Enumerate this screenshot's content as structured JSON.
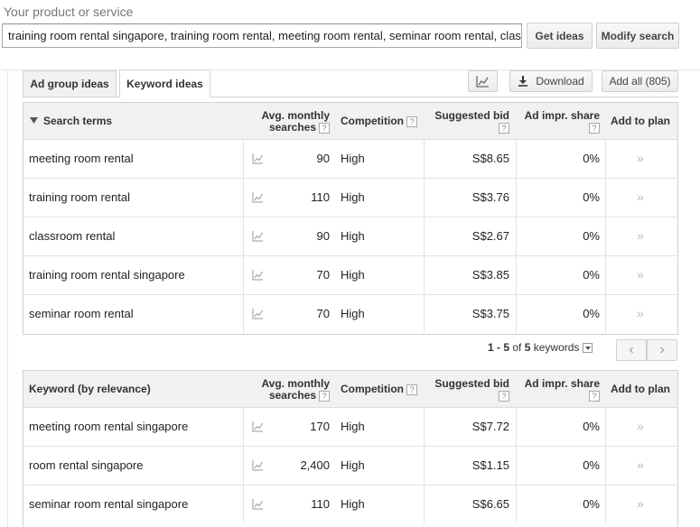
{
  "header": {
    "product_label": "Your product or service",
    "search_value": "training room rental singapore, training room rental, meeting room rental, seminar room rental, classroom rental",
    "get_ideas": "Get ideas",
    "modify_search": "Modify search"
  },
  "tabs": [
    {
      "label": "Ad group ideas"
    },
    {
      "label": "Keyword ideas"
    }
  ],
  "toolbar": {
    "download": "Download",
    "add_all": "Add all (805)"
  },
  "search_terms_table": {
    "headers": {
      "term": "Search terms",
      "avg_line1": "Avg. monthly",
      "avg_line2": "searches",
      "competition": "Competition",
      "bid": "Suggested bid",
      "impr": "Ad impr. share",
      "add": "Add to plan"
    },
    "rows": [
      {
        "term": "meeting room rental",
        "searches": "90",
        "competition": "High",
        "bid": "S$8.65",
        "impr": "0%"
      },
      {
        "term": "training room rental",
        "searches": "110",
        "competition": "High",
        "bid": "S$3.76",
        "impr": "0%"
      },
      {
        "term": "classroom rental",
        "searches": "90",
        "competition": "High",
        "bid": "S$2.67",
        "impr": "0%"
      },
      {
        "term": "training room rental singapore",
        "searches": "70",
        "competition": "High",
        "bid": "S$3.85",
        "impr": "0%"
      },
      {
        "term": "seminar room rental",
        "searches": "70",
        "competition": "High",
        "bid": "S$3.75",
        "impr": "0%"
      }
    ]
  },
  "pager": {
    "range": "1 - 5",
    "of": "of",
    "total": "5",
    "unit": "keywords"
  },
  "keyword_table": {
    "headers": {
      "term": "Keyword (by relevance)",
      "avg_line1": "Avg. monthly",
      "avg_line2": "searches",
      "competition": "Competition",
      "bid": "Suggested bid",
      "impr": "Ad impr. share",
      "add": "Add to plan"
    },
    "rows": [
      {
        "term": "meeting room rental singapore",
        "searches": "170",
        "competition": "High",
        "bid": "S$7.72",
        "impr": "0%"
      },
      {
        "term": "room rental singapore",
        "searches": "2,400",
        "competition": "High",
        "bid": "S$1.15",
        "impr": "0%"
      },
      {
        "term": "seminar room rental singapore",
        "searches": "110",
        "competition": "High",
        "bid": "S$6.65",
        "impr": "0%"
      }
    ]
  },
  "icons": {
    "trend": "trend-chart-icon",
    "add": "add-to-plan-icon",
    "download": "download-icon",
    "sort": "sort-triangle-icon",
    "help": "?"
  }
}
